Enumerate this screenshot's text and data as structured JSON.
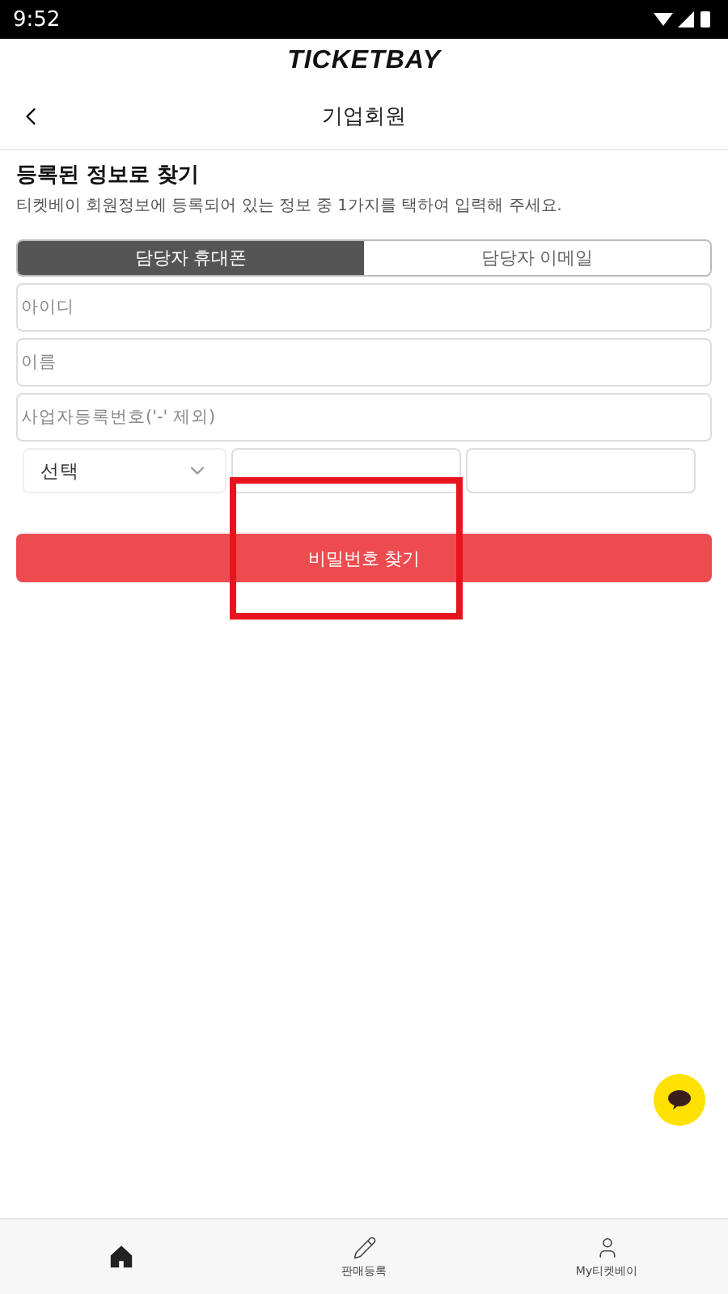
{
  "status_bar": {
    "time": "9:52"
  },
  "brand": {
    "logo": "TICKETBAY"
  },
  "header": {
    "title": "기업회원"
  },
  "section": {
    "heading": "등록된 정보로 찾기",
    "description": "티켓베이 회원정보에 등록되어 있는 정보 중 1가지를 택하여 입력해 주세요."
  },
  "tabs": [
    {
      "label": "담당자 휴대폰",
      "selected": true
    },
    {
      "label": "담당자 이메일",
      "selected": false
    }
  ],
  "fields": [
    {
      "placeholder": "아이디"
    },
    {
      "placeholder": "이름"
    },
    {
      "placeholder": "사업자등록번호('-' 제외)"
    }
  ],
  "phone": {
    "select": "선택"
  },
  "submit": {
    "label": "비밀번호 찾기",
    "highlighted": true
  },
  "bottom_nav": [
    {
      "kind": "home",
      "selected": true
    },
    {
      "kind": "pencil",
      "label": "판매등록",
      "selected": false
    },
    {
      "kind": "person",
      "label": "My티켓베이",
      "selected": false
    }
  ]
}
